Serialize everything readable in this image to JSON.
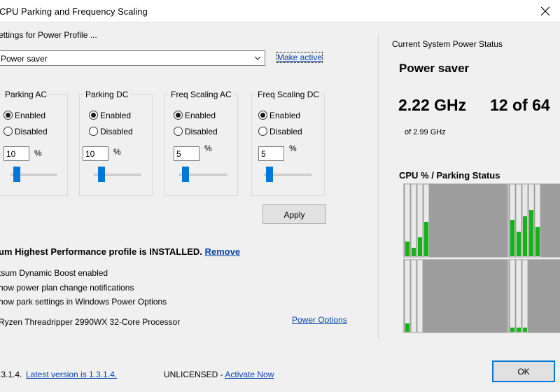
{
  "window": {
    "title": "CPU Parking and Frequency Scaling"
  },
  "profile": {
    "section_label": "ettings for Power Profile ...",
    "selected": "Power saver",
    "make_active": "Make active"
  },
  "groups": [
    {
      "legend": "Parking AC",
      "enabled_label": "Enabled",
      "disabled_label": "Disabled",
      "value": "10",
      "unit": "%",
      "enabled": true
    },
    {
      "legend": "Parking DC",
      "enabled_label": "Enabled",
      "disabled_label": "Disabled",
      "value": "10",
      "unit": "%",
      "enabled": true
    },
    {
      "legend": "Freq Scaling AC",
      "enabled_label": "Enabled",
      "disabled_label": "Disabled",
      "value": "5",
      "unit": "%",
      "enabled": true
    },
    {
      "legend": "Freq Scaling DC",
      "enabled_label": "Enabled",
      "disabled_label": "Disabled",
      "value": "5",
      "unit": "%",
      "enabled": true
    }
  ],
  "apply_label": "Apply",
  "ultimate": {
    "text": "um Highest Performance profile is INSTALLED.",
    "remove": "Remove"
  },
  "options": [
    "tsum Dynamic Boost enabled",
    "how power plan change notifications",
    "how park settings in Windows Power Options"
  ],
  "processor": "Ryzen Threadripper 2990WX 32-Core Processor",
  "power_options_link": "Power Options",
  "status": {
    "label": "Current System Power Status",
    "profile": "Power saver",
    "freq": "2.22 GHz",
    "cores": "12 of 64",
    "max_freq": "of 2.99 GHz"
  },
  "cpu_label": "CPU % / Parking Status",
  "cpu_panels": [
    {
      "cores": [
        {
          "fill": 0.2
        },
        {
          "fill": 0.12
        },
        {
          "fill": 0.26
        },
        {
          "fill": 0.47
        }
      ]
    },
    {
      "cores": [
        {
          "fill": 0.5
        },
        {
          "fill": 0.34
        },
        {
          "fill": 0.55
        },
        {
          "fill": 0.63
        },
        {
          "fill": 0.4
        }
      ]
    },
    {
      "cores": [
        {
          "fill": 0.12
        },
        {
          "fill": 0.0
        },
        {
          "fill": 0.0
        }
      ]
    },
    {
      "cores": [
        {
          "fill": 0.06
        },
        {
          "fill": 0.06
        },
        {
          "fill": 0.06
        }
      ]
    }
  ],
  "footer": {
    "version": ".3.1.4.",
    "latest": "Latest version is 1.3.1.4.",
    "license": "UNLICENSED - ",
    "activate": "Activate Now"
  },
  "ok_label": "OK",
  "colors": {
    "accent": "#0078d7",
    "core_fill": "#16b316",
    "link": "#0645ad"
  }
}
